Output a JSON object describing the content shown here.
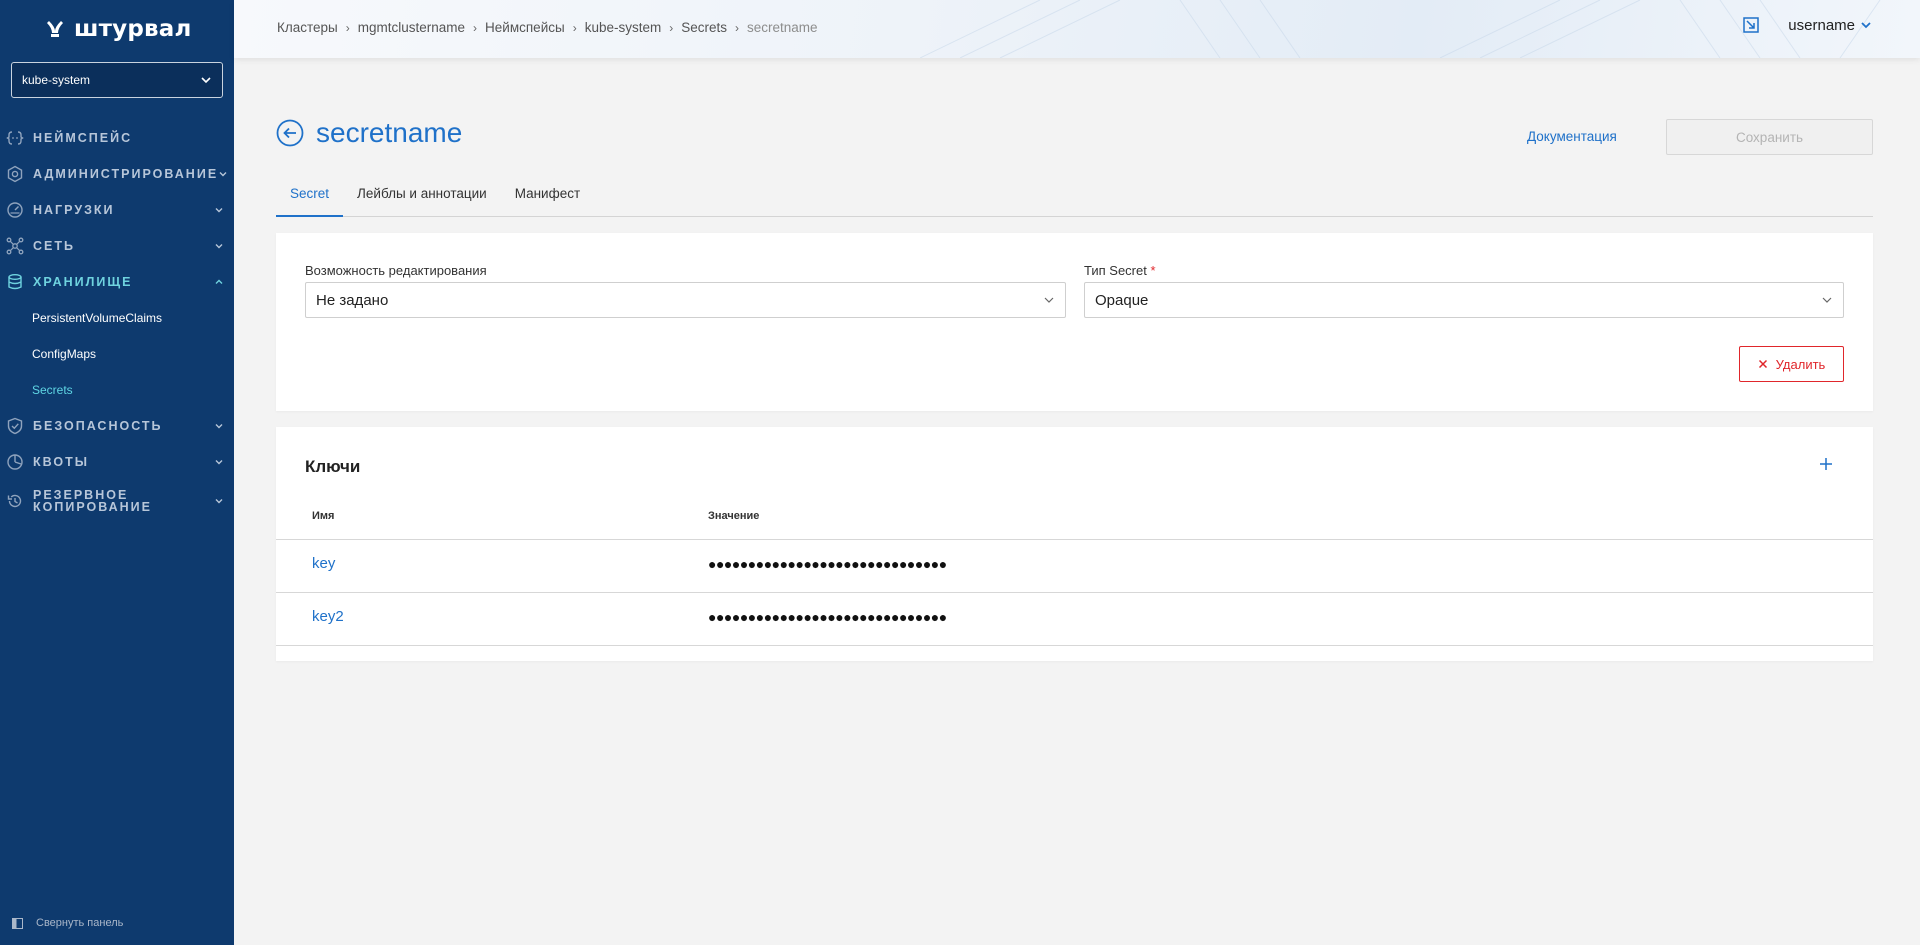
{
  "brand": {
    "name": "штурвал"
  },
  "namespace_select": {
    "value": "kube-system"
  },
  "nav": {
    "items": [
      {
        "label": "НЕЙМСПЕЙС",
        "icon": "braces-icon"
      },
      {
        "label": "АДМИНИСТРИРОВАНИЕ",
        "icon": "gear-icon"
      },
      {
        "label": "НАГРУЗКИ",
        "icon": "gauge-icon"
      },
      {
        "label": "СЕТЬ",
        "icon": "network-icon"
      },
      {
        "label": "ХРАНИЛИЩЕ",
        "icon": "database-icon"
      },
      {
        "label": "БЕЗОПАСНОСТЬ",
        "icon": "shield-icon"
      },
      {
        "label": "КВОТЫ",
        "icon": "quota-icon"
      },
      {
        "label": "РЕЗЕРВНОЕ КОПИРОВАНИЕ",
        "icon": "backup-icon"
      }
    ],
    "storage_subitems": [
      "PersistentVolumeClaims",
      "ConfigMaps",
      "Secrets"
    ],
    "collapse_label": "Свернуть панель"
  },
  "breadcrumb": [
    "Кластеры",
    "mgmtclustername",
    "Неймспейсы",
    "kube-system",
    "Secrets",
    "secretname"
  ],
  "user": {
    "name": "username"
  },
  "page": {
    "title": "secretname",
    "doc_link": "Документация",
    "save_label": "Сохранить"
  },
  "tabs": [
    "Secret",
    "Лейблы и аннотации",
    "Манифест"
  ],
  "form": {
    "editability_label": "Возможность редактирования",
    "editability_value": "Не задано",
    "type_label": "Тип Secret",
    "type_required": "*",
    "type_value": "Opaque",
    "delete_label": "Удалить"
  },
  "keys": {
    "title": "Ключи",
    "col_name": "Имя",
    "col_value": "Значение",
    "rows": [
      {
        "name": "key",
        "value": "●●●●●●●●●●●●●●●●●●●●●●●●●●●●●●"
      },
      {
        "name": "key2",
        "value": "●●●●●●●●●●●●●●●●●●●●●●●●●●●●●●"
      }
    ]
  },
  "colors": {
    "sidebar": "#0e3a6e",
    "accent": "#1f71c9",
    "danger": "#e0262b",
    "active_nav": "#6fd3df"
  }
}
